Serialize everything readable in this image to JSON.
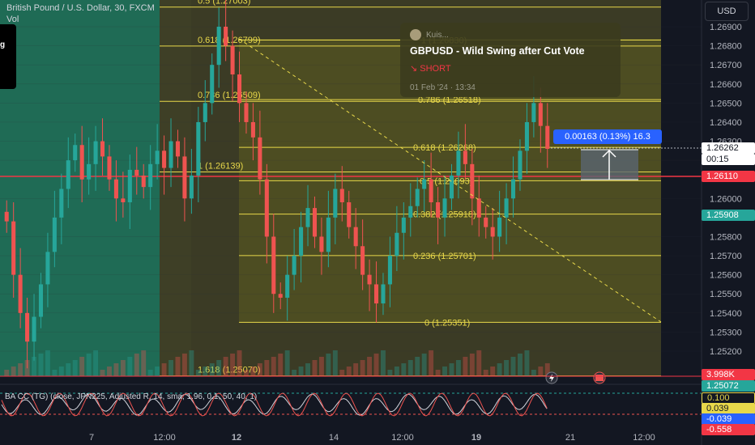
{
  "header": {
    "symbol_title": "British Pound / U.S. Dollar, 30, FXCM",
    "volume_label": "Vol",
    "panel_letter": "g"
  },
  "currency_button": "USD",
  "idea_card": {
    "author": "Kuis...",
    "title": "GBPUSD - Wild Swing after Cut Vote",
    "direction": "↘ SHORT",
    "date": "01 Feb '24 · 13:34"
  },
  "measure_label": "0.00163 (0.13%) 16.3",
  "fib_levels": [
    {
      "label": "0.5 (1.27003)",
      "price": 1.27003,
      "full": true
    },
    {
      "label": "0.618 (1.26799)",
      "price": 1.26799,
      "full": true
    },
    {
      "label": "0.786 (1.26509)",
      "price": 1.26509,
      "full": true
    },
    {
      "label": "1 (1.26139)",
      "price": 1.26139,
      "full": true
    },
    {
      "label": "1.618 (1.25070)",
      "price": 1.2507,
      "full": true
    }
  ],
  "fib_levels_2": [
    {
      "label": "1 (1.26830)",
      "price": 1.2683
    },
    {
      "label": "0.786 (1.26518)",
      "price": 1.26518
    },
    {
      "label": "0.618 (1.26268)",
      "price": 1.26268
    },
    {
      "label": "0.5 (1.26093)",
      "price": 1.26093
    },
    {
      "label": "0.382 (1.25918)",
      "price": 1.25918
    },
    {
      "label": "0.236 (1.25701)",
      "price": 1.25701
    },
    {
      "label": "0 (1.25351)",
      "price": 1.25351
    }
  ],
  "price_axis": {
    "ticks": [
      "1.26900",
      "1.26800",
      "1.26700",
      "1.26600",
      "1.26500",
      "1.26400",
      "1.26300",
      "1.26200",
      "1.26000",
      "1.25800",
      "1.25700",
      "1.25600",
      "1.25500",
      "1.25400",
      "1.25300",
      "1.25200"
    ],
    "current_price": "1.26262",
    "countdown": "00:15",
    "red_level": "1.26110",
    "green_level": "1.25908",
    "vol_label": "3.998K",
    "vol_price": "1.25072"
  },
  "oscillator": {
    "title": "BA CC (TG) (close, JPN225, Adjusted R, 14, sma, 1.96, 0.1, 50, 40, 1)",
    "values": [
      "0.100",
      "0.039",
      "-0.039",
      "-0.558"
    ]
  },
  "time_axis": [
    "7",
    "12:00",
    "12",
    "14",
    "12:00",
    "19",
    "21",
    "12:00"
  ],
  "colors": {
    "up": "#26a69a",
    "down": "#ef5350",
    "fib_zone": "#4d4d22",
    "green_zone": "#1f6b55",
    "red_line": "#f23645",
    "yellow": "#e8d84a"
  },
  "chart_data": {
    "type": "candlestick",
    "symbol": "GBPUSD",
    "timeframe": "30",
    "ylim": [
      1.2512,
      1.2705
    ],
    "closes": [
      1.2588,
      1.256,
      1.254,
      1.2525,
      1.2538,
      1.2555,
      1.2572,
      1.259,
      1.2605,
      1.262,
      1.2628,
      1.261,
      1.2618,
      1.263,
      1.2622,
      1.261,
      1.26,
      1.2598,
      1.2615,
      1.2612,
      1.2606,
      1.2618,
      1.2625,
      1.2616,
      1.263,
      1.2622,
      1.26,
      1.2612,
      1.264,
      1.265,
      1.267,
      1.269,
      1.268,
      1.2665,
      1.265,
      1.264,
      1.2632,
      1.261,
      1.258,
      1.255,
      1.2548,
      1.256,
      1.257,
      1.2585,
      1.2595,
      1.258,
      1.2572,
      1.259,
      1.2605,
      1.2598,
      1.2585,
      1.2575,
      1.256,
      1.2555,
      1.2545,
      1.2555,
      1.257,
      1.2582,
      1.259,
      1.2596,
      1.2605,
      1.261,
      1.2598,
      1.259,
      1.26,
      1.2612,
      1.2625,
      1.2618,
      1.26,
      1.259,
      1.2585,
      1.258,
      1.259,
      1.26,
      1.261,
      1.2625,
      1.264,
      1.265,
      1.2638,
      1.2626
    ]
  }
}
